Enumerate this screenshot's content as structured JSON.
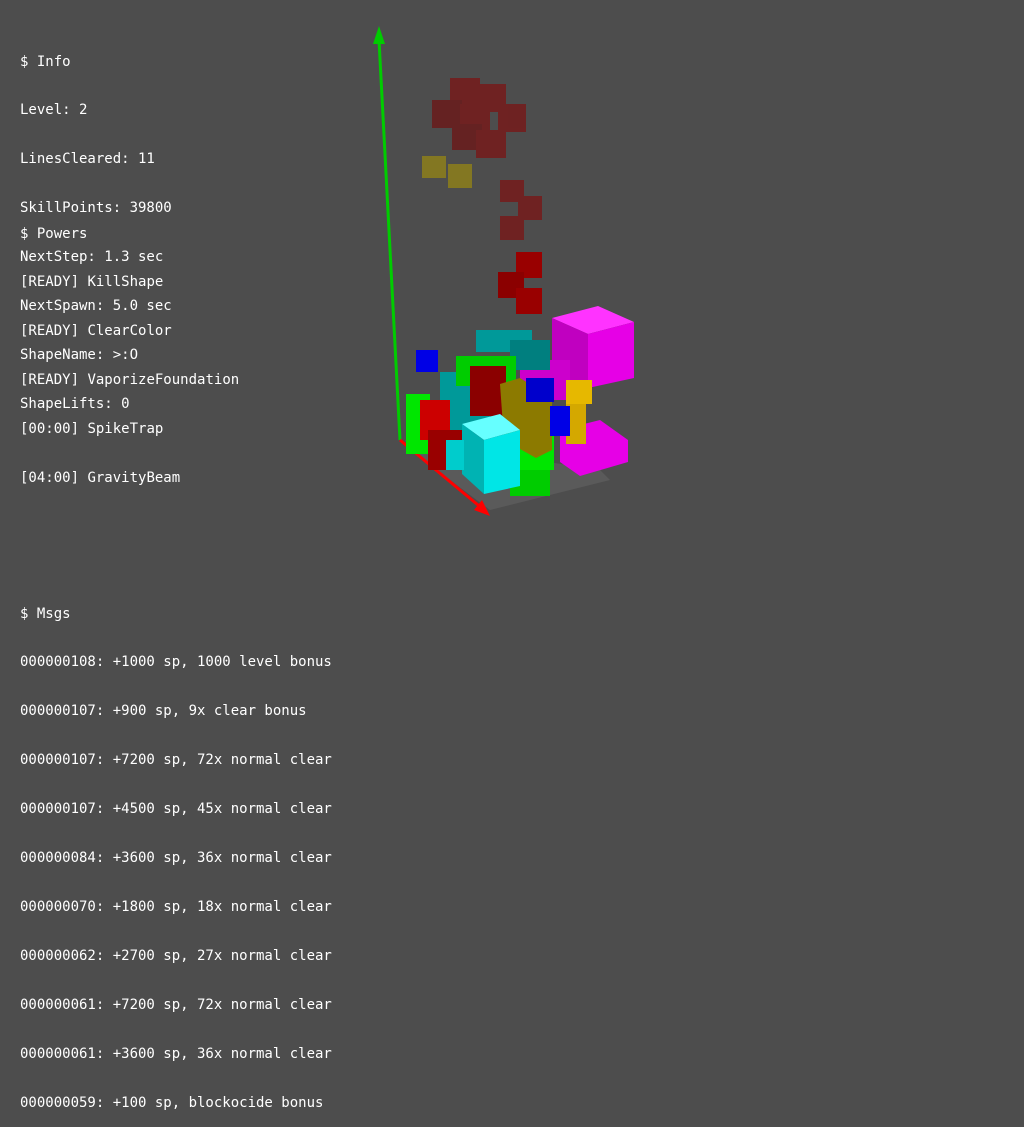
{
  "info": {
    "header": "$ Info",
    "lines": [
      "Level: 2",
      "LinesCleared: 11",
      "SkillPoints: 39800",
      "NextStep: 1.3 sec",
      "NextSpawn: 5.0 sec",
      "ShapeName: >:O",
      "ShapeLifts: 0"
    ]
  },
  "powers": {
    "header": "$ Powers",
    "items": [
      {
        "status": "[READY]",
        "name": "KillShape"
      },
      {
        "status": "[READY]",
        "name": "ClearColor"
      },
      {
        "status": "[READY]",
        "name": "VaporizeFoundation"
      },
      {
        "status": "[00:00]",
        "name": "SpikeTrap"
      },
      {
        "status": "[04:00]",
        "name": "GravityBeam"
      }
    ]
  },
  "msgs": {
    "header": "$ Msgs",
    "lines": [
      "000000108: +1000 sp, 1000 level bonus",
      "000000107: +900 sp, 9x clear bonus",
      "000000107: +7200 sp, 72x normal clear",
      "000000107: +4500 sp, 45x normal clear",
      "000000084: +3600 sp, 36x normal clear",
      "000000070: +1800 sp, 18x normal clear",
      "000000062: +2700 sp, 27x normal clear",
      "000000061: +7200 sp, 72x normal clear",
      "000000061: +3600 sp, 36x normal clear",
      "000000059: +100 sp, blockocide bonus"
    ]
  },
  "colors": {
    "background": "#4d4d4d",
    "axis_y": "#00cc00",
    "axis_x": "#ff0000",
    "magenta": "#e600e6",
    "cyan": "#00e6e6",
    "green": "#00e600",
    "red": "#cc0000",
    "dark_red": "#990000",
    "yellow": "#e6b800",
    "olive": "#8c7a00",
    "blue": "#0000e6",
    "teal": "#009999"
  }
}
